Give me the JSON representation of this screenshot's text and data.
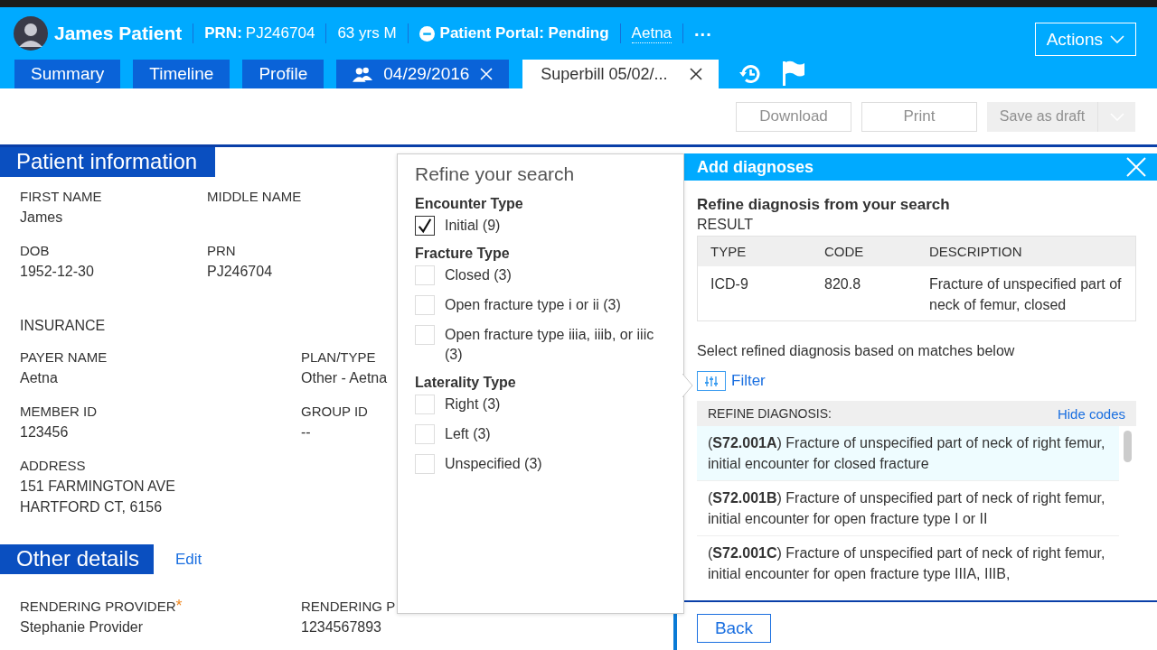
{
  "header": {
    "patient_name": "James Patient",
    "prn_label": "PRN:",
    "prn": "PJ246704",
    "age_sex": "63 yrs M",
    "portal_status": "Patient Portal: Pending",
    "insurance_link": "Aetna",
    "more": "...",
    "actions_button": "Actions"
  },
  "tabs": [
    {
      "label": "Summary",
      "kind": "nav",
      "selected": false
    },
    {
      "label": "Timeline",
      "kind": "nav",
      "selected": false
    },
    {
      "label": "Profile",
      "kind": "nav",
      "selected": false
    },
    {
      "label": "04/29/2016",
      "kind": "encounter",
      "selected": false
    },
    {
      "label": "Superbill 05/02/...",
      "kind": "document",
      "selected": true
    }
  ],
  "toolbar": {
    "buttons": [
      {
        "label": "Download",
        "disabled": true
      },
      {
        "label": "Print",
        "disabled": true
      }
    ],
    "save_button": {
      "label": "Save as draft",
      "disabled": true
    }
  },
  "patient_information": {
    "title": "Patient information",
    "personal": [
      {
        "label": "FIRST NAME",
        "value": "James"
      },
      {
        "label": "MIDDLE NAME"
      },
      {
        "label": "DOB",
        "value": "1952-12-30"
      },
      {
        "label": "PRN",
        "value": "PJ246704"
      }
    ],
    "insurance_heading": "INSURANCE",
    "insurance": [
      {
        "label": "PAYER NAME",
        "value": "Aetna"
      },
      {
        "label": "PLAN/TYPE",
        "value": "Other - Aetna"
      },
      {
        "label": "MEMBER ID",
        "value": "123456"
      },
      {
        "label": "GROUP ID",
        "value": "--"
      },
      {
        "label": "ADDRESS",
        "lines": [
          "151 FARMINGTON AVE",
          "HARTFORD CT, 6156"
        ]
      }
    ]
  },
  "other_details": {
    "title": "Other details",
    "edit_link": "Edit",
    "fields": [
      {
        "label": "RENDERING PROVIDER",
        "required_mark": "*",
        "value": "Stephanie Provider"
      },
      {
        "label": "RENDERING P",
        "value": "1234567893"
      }
    ]
  },
  "refine_popup": {
    "title": "Refine your search",
    "groups": [
      {
        "title": "Encounter Type",
        "options": [
          {
            "label": "Initial (9)",
            "checked": true
          }
        ]
      },
      {
        "title": "Fracture Type",
        "options": [
          {
            "label": "Closed (3)",
            "checked": false
          },
          {
            "label": "Open fracture type i or ii (3)",
            "checked": false
          },
          {
            "label": "Open fracture type iiia, iiib, or iiic (3)",
            "checked": false
          }
        ]
      },
      {
        "title": "Laterality Type",
        "options": [
          {
            "label": "Right (3)",
            "checked": false
          },
          {
            "label": "Left (3)",
            "checked": false
          },
          {
            "label": "Unspecified (3)",
            "checked": false
          }
        ]
      }
    ]
  },
  "add_diagnoses": {
    "title": "Add diagnoses",
    "subtitle": "Refine diagnosis from your search",
    "result_label": "RESULT",
    "result_table": {
      "columns": [
        "TYPE",
        "CODE",
        "DESCRIPTION"
      ],
      "rows": [
        [
          "ICD-9",
          "820.8",
          "Fracture of unspecified part of neck of femur, closed"
        ]
      ]
    },
    "instruction": "Select refined diagnosis based on matches below",
    "filter_link": "Filter",
    "refine_header": "REFINE DIAGNOSIS:",
    "hide_codes_link": "Hide codes",
    "matches": [
      {
        "text": "(**S72.001A**) Fracture of unspecified part of neck of right femur, initial encounter for closed fracture",
        "selected": true
      },
      {
        "text": "(**S72.001B**) Fracture of unspecified part of neck of right femur, initial encounter for open fracture type I or II",
        "selected": false
      },
      {
        "text": "(**S72.001C**) Fracture of unspecified part of neck of right femur, initial encounter for open fracture type IIIA, IIIB,",
        "selected": false
      }
    ],
    "back_button": "Back"
  }
}
